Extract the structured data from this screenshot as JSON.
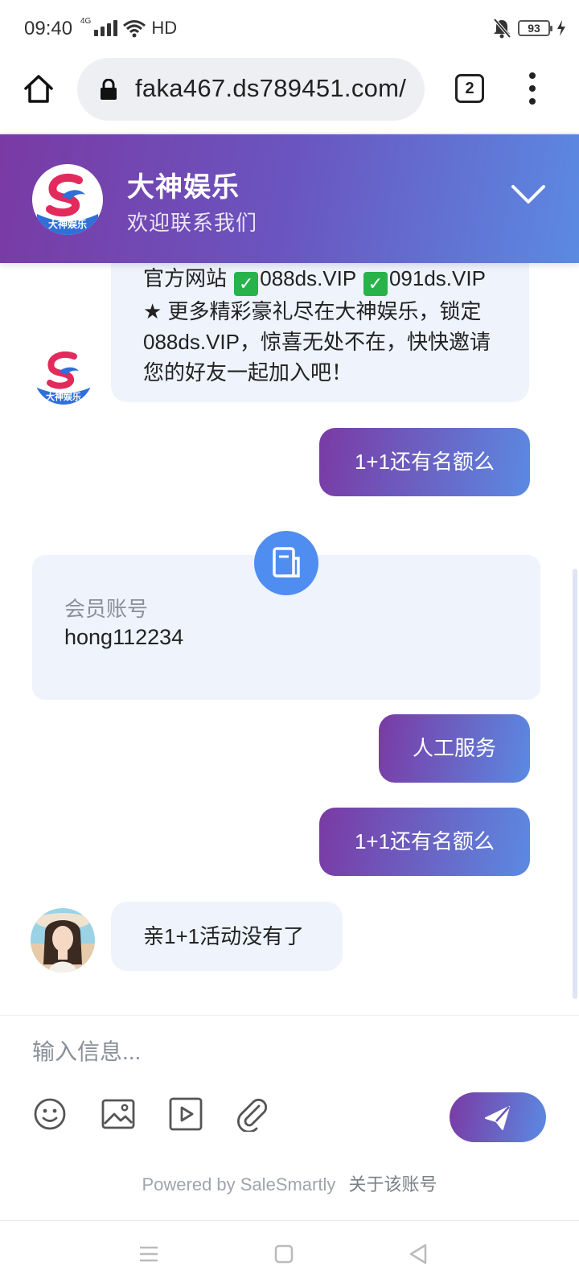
{
  "status_bar": {
    "time": "09:40",
    "network": "4G",
    "hd": "HD",
    "battery": "93"
  },
  "browser": {
    "url": "faka467.ds789451.com/",
    "tab_count": "2"
  },
  "chat_header": {
    "title": "大神娱乐",
    "subtitle": "欢迎联系我们",
    "logo_text": "大神娱乐"
  },
  "messages": {
    "bot_text_line1a": "官方网站 ",
    "bot_text_line1b": "088ds.VIP ",
    "bot_text_rest": "091ds.VIP ★ 更多精彩豪礼尽在大神娱乐，锁定 088ds.VIP，惊喜无处不在，快快邀请您的好友一起加入吧！",
    "user_msg_1": "1+1还有名额么",
    "form_label": "会员账号",
    "form_value": "hong112234",
    "user_msg_2": "人工服务",
    "user_msg_3": "1+1还有名额么",
    "agent_reply": "亲1+1活动没有了"
  },
  "composer": {
    "placeholder": "输入信息...",
    "powered_by": "Powered by SaleSmartly",
    "about_account": "关于该账号"
  },
  "colors": {
    "gradient_start": "#7a3aa4",
    "gradient_end": "#5b8ae2",
    "bubble_in": "#eef3fc",
    "form_icon": "#4f8ef0"
  }
}
